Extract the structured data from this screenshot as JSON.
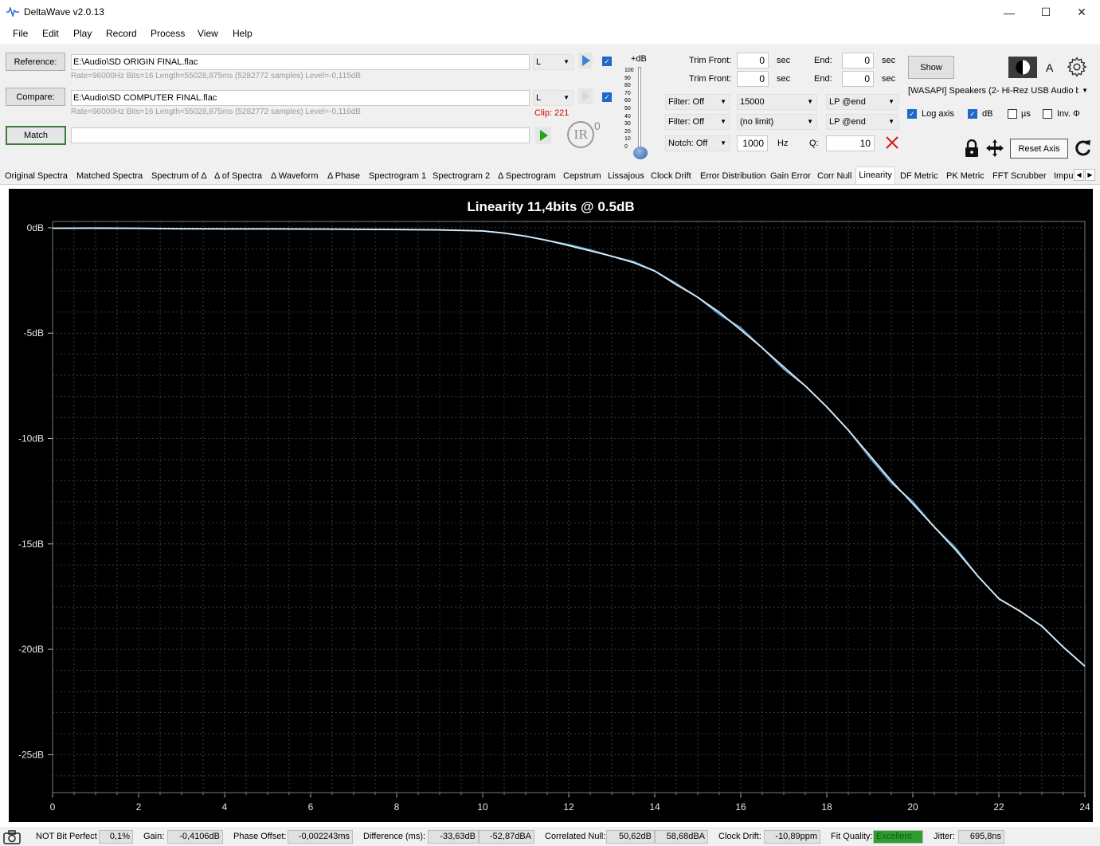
{
  "window": {
    "title": "DeltaWave v2.0.13"
  },
  "menu": [
    "File",
    "Edit",
    "Play",
    "Record",
    "Process",
    "View",
    "Help"
  ],
  "reference": {
    "button": "Reference:",
    "path": "E:\\Audio\\SD ORIGIN FINAL.flac",
    "info": "Rate=96000Hz Bits=16 Length=55028,875ms (5282772 samples) Level=-0,115dB",
    "channel": "L"
  },
  "compare": {
    "button": "Compare:",
    "path": "E:\\Audio\\SD COMPUTER FINAL.flac",
    "info": "Rate=96000Hz Bits=16 Length=55028,875ms (5282772 samples) Level=-0,116dB",
    "channel": "L",
    "clip": "Clip: 221"
  },
  "match": {
    "button": "Match"
  },
  "ir": {
    "label": "IR",
    "sup": "0"
  },
  "level_meter": {
    "label": "+dB",
    "ticks": [
      "100",
      "90",
      "80",
      "70",
      "60",
      "50",
      "40",
      "30",
      "20",
      "10",
      "0"
    ]
  },
  "trim": {
    "front_label": "Trim Front:",
    "end_label": "End:",
    "unit": "sec",
    "ref_front": "0",
    "ref_end": "0",
    "cmp_front": "0",
    "cmp_end": "0"
  },
  "filters": {
    "filter1": "Filter: Off",
    "filter1_value": "15000",
    "filter1_mode": "LP @end",
    "filter2": "Filter: Off",
    "filter2_value": "(no limit)",
    "filter2_mode": "LP @end",
    "notch": "Notch: Off",
    "notch_freq": "1000",
    "notch_unit": "Hz",
    "q_label": "Q:",
    "q_value": "10"
  },
  "output": {
    "show_button": "Show",
    "device": "[WASAPI] Speakers (2- Hi-Rez USB Audio b",
    "a_label": "A"
  },
  "options": {
    "log_axis": {
      "label": "Log axis",
      "checked": true
    },
    "db": {
      "label": "dB",
      "checked": true
    },
    "us": {
      "label": "µs",
      "checked": false
    },
    "inv": {
      "label": "Inv. Φ",
      "checked": false
    }
  },
  "reset_axis": "Reset Axis",
  "tabs": [
    "Original Spectra",
    "Matched Spectra",
    "Spectrum of Δ",
    "Δ of Spectra",
    "Δ Waveform",
    "Δ Phase",
    "Spectrogram 1",
    "Spectrogram 2",
    "Δ Spectrogram",
    "Cepstrum",
    "Lissajous",
    "Clock Drift",
    "Error Distribution",
    "Gain Error",
    "Corr Null",
    "Linearity",
    "DF Metric",
    "PK Metric",
    "FFT Scrubber",
    "Impu"
  ],
  "active_tab": "Linearity",
  "chart_data": {
    "type": "line",
    "title": "Linearity 11,4bits @ 0.5dB",
    "xlim": [
      0,
      24
    ],
    "ylim": [
      -26.8,
      0.3
    ],
    "x_ticks": [
      "0",
      "2",
      "4",
      "6",
      "8",
      "10",
      "12",
      "14",
      "16",
      "18",
      "20",
      "22",
      "24"
    ],
    "y_ticks": [
      {
        "value": 0,
        "label": "0dB"
      },
      {
        "value": -5,
        "label": "-5dB"
      },
      {
        "value": -10,
        "label": "-10dB"
      },
      {
        "value": -15,
        "label": "-15dB"
      },
      {
        "value": -20,
        "label": "-20dB"
      },
      {
        "value": -25,
        "label": "-25dB"
      }
    ],
    "grid": true,
    "series": [
      {
        "color": "#58a8d8",
        "x": [
          0,
          1,
          2,
          3,
          4,
          5,
          6,
          7,
          8,
          9,
          10,
          10.5,
          11,
          11.5,
          12,
          12.5,
          13,
          13.5,
          14,
          14.5,
          15,
          15.5,
          16,
          16.5,
          17,
          17.5,
          18,
          18.5,
          19,
          19.5,
          20,
          20.5,
          21,
          21.5,
          22,
          22.5,
          23,
          23.5,
          24
        ],
        "y": [
          -0.02,
          -0.01,
          -0.02,
          -0.05,
          -0.05,
          -0.05,
          -0.06,
          -0.07,
          -0.08,
          -0.1,
          -0.15,
          -0.25,
          -0.4,
          -0.6,
          -0.8,
          -1.05,
          -1.35,
          -1.6,
          -2.05,
          -2.65,
          -3.3,
          -4.1,
          -4.75,
          -5.7,
          -6.7,
          -7.5,
          -8.5,
          -9.6,
          -10.9,
          -12.1,
          -13.0,
          -14.2,
          -15.2,
          -16.5,
          -17.6,
          -18.2,
          -18.9,
          -19.9,
          -20.8
        ]
      },
      {
        "color": "#e8eef4",
        "x": [
          0,
          1,
          2,
          3,
          4,
          5,
          6,
          7,
          8,
          9,
          10,
          10.5,
          11,
          11.5,
          12,
          12.5,
          13,
          13.5,
          14,
          14.5,
          15,
          15.5,
          16,
          16.5,
          17,
          17.5,
          18,
          18.5,
          19,
          19.5,
          20,
          20.5,
          21,
          21.5,
          22,
          22.5,
          23,
          23.5,
          24
        ],
        "y": [
          -0.02,
          -0.02,
          -0.03,
          -0.04,
          -0.05,
          -0.05,
          -0.06,
          -0.07,
          -0.08,
          -0.1,
          -0.15,
          -0.25,
          -0.4,
          -0.6,
          -0.85,
          -1.1,
          -1.35,
          -1.65,
          -2.05,
          -2.7,
          -3.3,
          -4.0,
          -4.85,
          -5.7,
          -6.6,
          -7.5,
          -8.5,
          -9.6,
          -10.8,
          -12.0,
          -13.1,
          -14.2,
          -15.3,
          -16.5,
          -17.6,
          -18.2,
          -18.9,
          -19.9,
          -20.8
        ]
      }
    ]
  },
  "status": {
    "bit_perfect": "NOT Bit Perfect",
    "bit_perfect_value": "0,1%",
    "gain_label": "Gain:",
    "gain_value": "-0,4106dB",
    "phase_label": "Phase Offset:",
    "phase_value": "-0,002243ms",
    "diff_label": "Difference (ms):",
    "diff_value1": "-33,63dB",
    "diff_value2": "-52,87dBA",
    "null_label": "Correlated Null:",
    "null_value1": "50,62dB",
    "null_value2": "58,68dBA",
    "drift_label": "Clock Drift:",
    "drift_value": "-10,89ppm",
    "fit_label": "Fit Quality:",
    "fit_value": "Excellent",
    "jitter_label": "Jitter:",
    "jitter_value": "695,8ns"
  },
  "colors": {
    "fit_good": "#2e9e2e",
    "accent": "#1f67c8",
    "clip": "#d40000"
  }
}
